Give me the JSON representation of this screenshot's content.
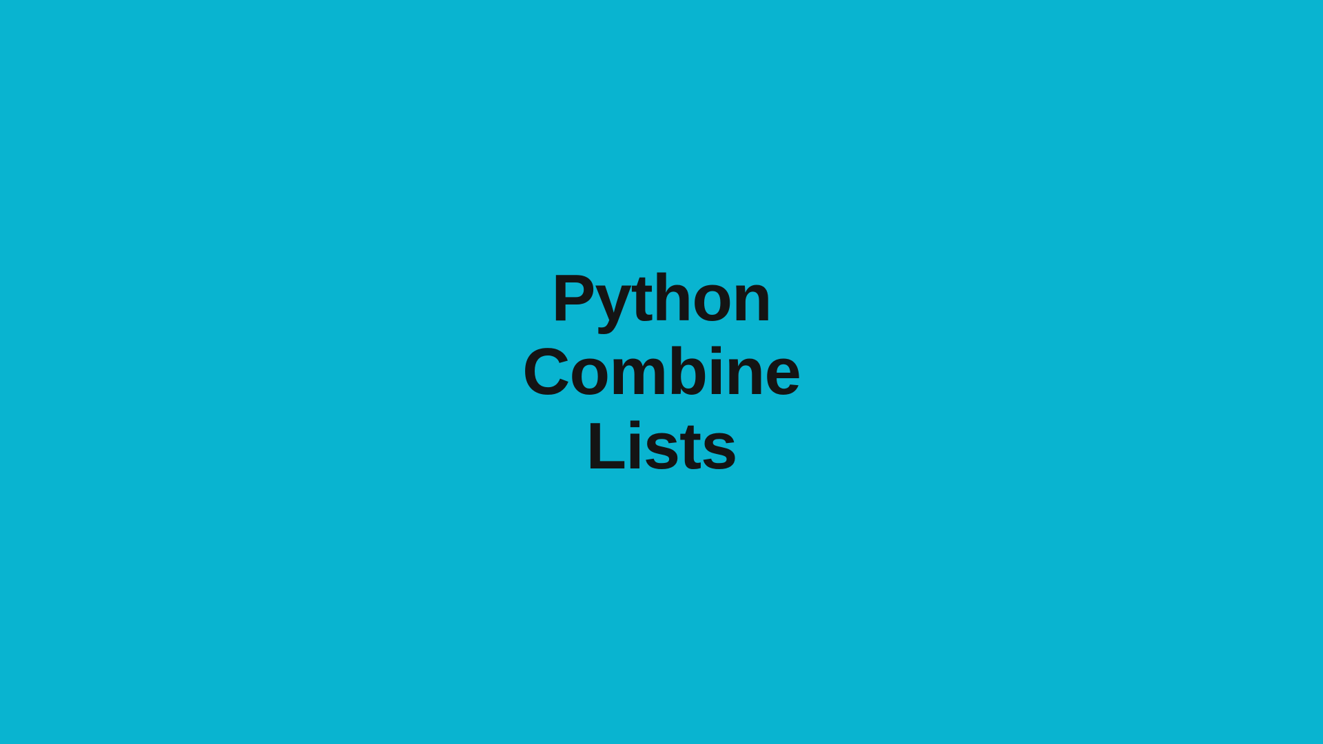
{
  "title": {
    "line1": "Python",
    "line2": "Combine",
    "line3": "Lists"
  }
}
